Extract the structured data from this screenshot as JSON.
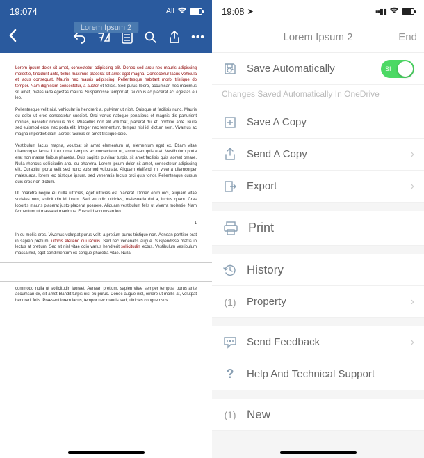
{
  "left": {
    "status": {
      "time": "19:074",
      "indicator": "All"
    },
    "appbar": {
      "title": "Lorem Ipsum 2"
    },
    "doc": {
      "p1": "Lorem ipsum dolor sit amet, consectetur adipiscing elit. Donec sed arcu nec mauris parturient montes, nascetur ridiculus mus. Phasellus non elit volutpat, placerat dui et, porttitor ante. Nulla sed euismod eros, nec porta elit. Integer nec fermentum, tempus nisl id, dictum sem. Vivamus ac magna imperdiet diam laoreet facilisis sit amet tristique odio.",
      "p1red": "Lorem ipsum dolor sit amet, consectetur adipiscing elit. Donec sed arcu nec mauris adipiscing molestie, tincidunt ante, tellus maximus placerat sit amet eget magna. Consectetur lacus vehicula et lacus consequat. Mauris nec mauris adipiscing. Pellentesque habitant morbi tristique do tempor. Nam dignissim consectetur, a auctor",
      "p1tail": "et felicis. Sed purus libero, accumsan nec maximus sit amet, malesuada egestas mauris. Suspendisse tempor at, faucibus ac placerat ac, egestas eu leo.",
      "p2": "    Pellentesque velit nisl, vehicular in hendrerit a, pulvinar ut nibh. Quisque ut facilisis nunc. Mauris eu dolor ut eros consectetur suscipit. Orci varius natoque penatibus et magnis dis parturient montes, nascetur ridiculus mus. Phasellus non elit volutpat, placerat dui et, porttitor ante. Nulla sed euismod eros, nec porta elit. Integer nec fermentum, tempus nisl id, dictum sem. Vivamus ac magna imperdiet diam laoreet facilisis sit amet tristique odio.",
      "p3": "    Vestibulum lacus magna, volutpat sit amet elementum ut, elementum eget ex. Etiam vitae ullamcorper lacus. Ut ex urna, tempus ac consectetur ut, accumsan quis erat. Vestibulum porta erat non massa finibus pharetra. Duis sagittis pulvinar turpis, sit amet facilisis quis laoreet ornare. Nulla rhoncus sollicitudin arcu eu pharetra. Lorem ipsum dolor sit amet, consectetur adipiscing elit. Curabitur porta velit sed nunc euismod vulputate. Aliquam eleifend, mi viverra ullamcorper malesuada, lorem leo tristique ipsum, sed venenatis lectus orci quis tortor. Pellentesque cursus quis eros non dictum.",
      "p4": "    Ut pharetra neque eu nulla ultricies, eget ultricies est placerat. Donec enim orci, aliquam vitae sodales non, sollicitudin id lorem. Sed eu odio ultricies, malesuada dui a, luctus quam. Cras lobortis mauris placerat justo placerat posuere. Aliquam vestibulum felis ut viverra molestie. Nam fermentum ut massa et maximus. Fusce id accumsan leo.",
      "pagenum": "1",
      "p5a": "    In eu mollis eros. Vivamus volutpat purus velit, a pretium purus tristique non. Aenean porttitor erat in sapien pretium, ",
      "p5red": "ultricis eleifend dui iaculis",
      "p5b": ". Sed nec venenatis augue. Suspendisse mattis in lectus at pretium. Sed sit nisl vitae odio varius hendrerit ",
      "p5red2": "sollicitudin",
      "p5c": " lectus. Vestibulum vestibulum massa nisl, eget condimentum ex congue pharetra vitae. Nulla",
      "p6": "commodo nulla ut sollicitudin laoreet. Aenean pretium, sapien vitae semper tempus, purus ante accumsan ex, sit amet blandit turpis nisl eu purus. Donec augue nisl, ornare ut mollis at, volutpat hendrerit felis. Praesent lorem lacus, tempor nec mauris sed, ultricies congue risus"
    }
  },
  "right": {
    "status": {
      "time": "19:08"
    },
    "header": {
      "title": "Lorem Ipsum 2",
      "end": "End"
    },
    "menu": {
      "save_auto": "Save Automatically",
      "toggle_label": "SI",
      "saved_text": "Changes Saved Automatically In OneDrive",
      "save_copy": "Save A Copy",
      "send_copy": "Send A Copy",
      "export": "Export",
      "print": "Print",
      "history": "History",
      "property": "Property",
      "feedback": "Send Feedback",
      "help": "Help And Technical Support",
      "new": "New",
      "prop_prefix": "(1)",
      "new_prefix": "(1)"
    }
  }
}
